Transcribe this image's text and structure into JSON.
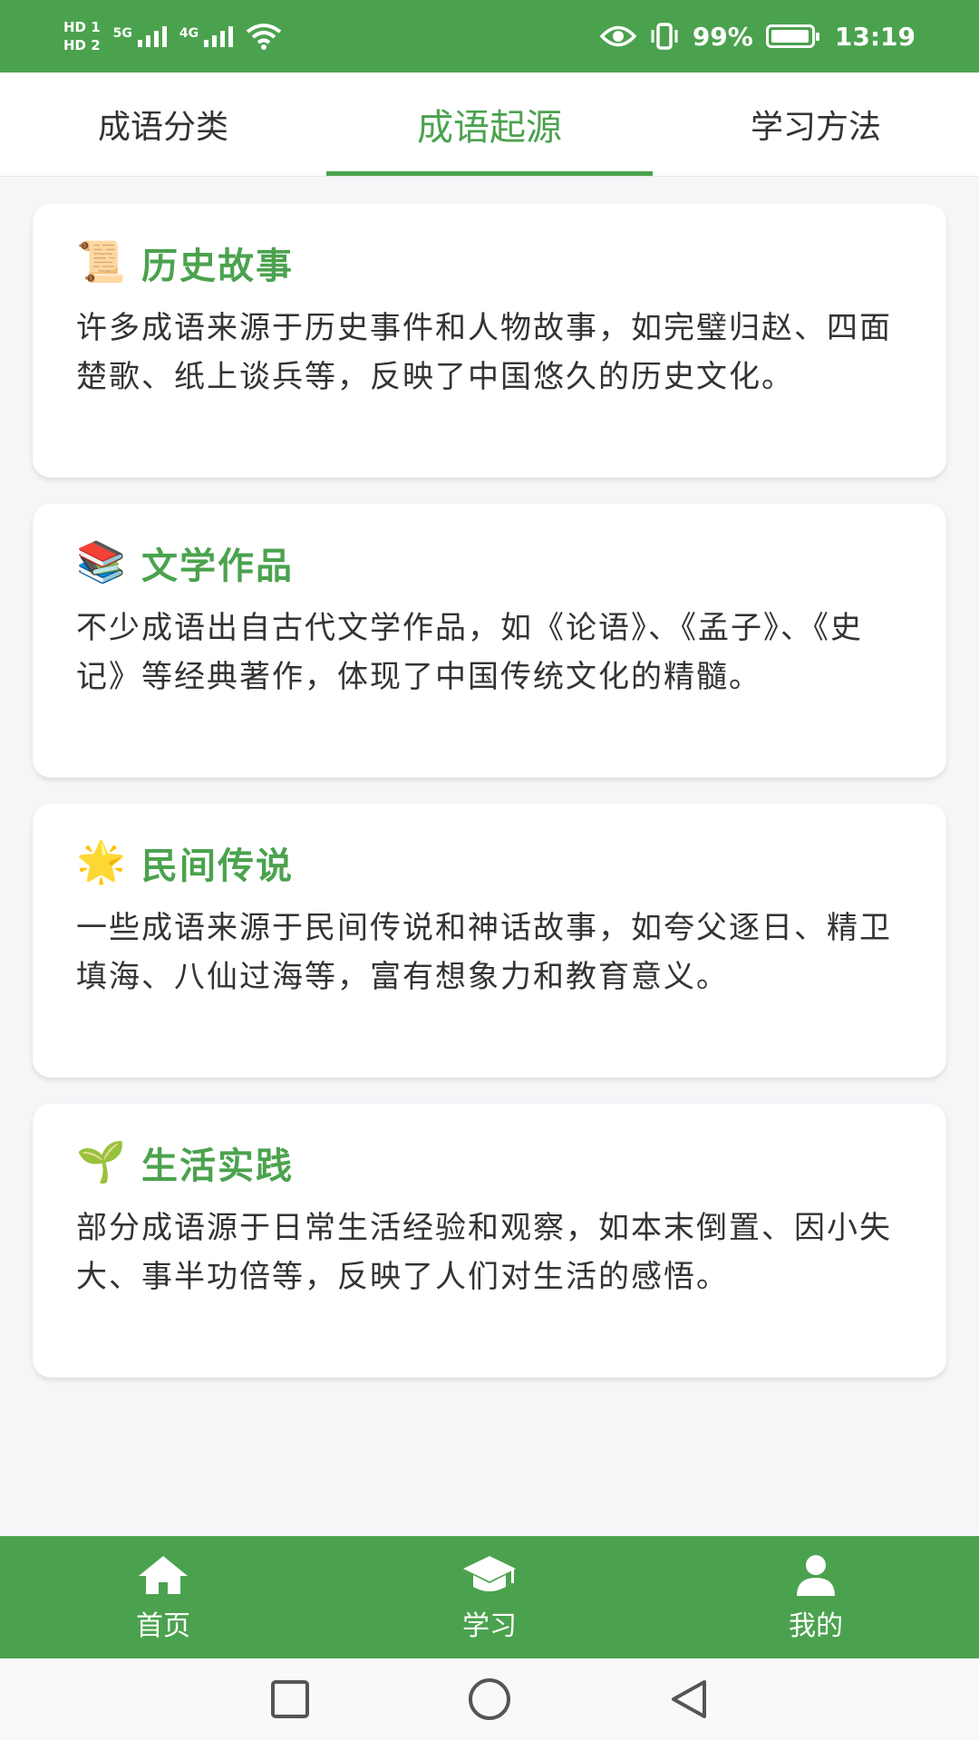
{
  "status_bar": {
    "hd1": "HD 1",
    "hd2": "HD 2",
    "signal1": "5G",
    "signal2": "4G",
    "battery_percent": "99%",
    "time": "13:19"
  },
  "tabs": [
    {
      "label": "成语分类"
    },
    {
      "label": "成语起源"
    },
    {
      "label": "学习方法"
    }
  ],
  "cards": [
    {
      "icon": "📜",
      "title": "历史故事",
      "description": "许多成语来源于历史事件和人物故事，如完璧归赵、四面楚歌、纸上谈兵等，反映了中国悠久的历史文化。"
    },
    {
      "icon": "📚",
      "title": "文学作品",
      "description": "不少成语出自古代文学作品，如《论语》、《孟子》、《史记》等经典著作，体现了中国传统文化的精髓。"
    },
    {
      "icon": "🌟",
      "title": "民间传说",
      "description": "一些成语来源于民间传说和神话故事，如夸父逐日、精卫填海、八仙过海等，富有想象力和教育意义。"
    },
    {
      "icon": "🌱",
      "title": "生活实践",
      "description": "部分成语源于日常生活经验和观察，如本末倒置、因小失大、事半功倍等，反映了人们对生活的感悟。"
    }
  ],
  "bottom_nav": [
    {
      "label": "首页",
      "icon": "home-icon"
    },
    {
      "label": "学习",
      "icon": "graduation-cap-icon"
    },
    {
      "label": "我的",
      "icon": "user-icon"
    }
  ],
  "colors": {
    "accent": "#4ba24e",
    "background": "#f5f6f8"
  }
}
